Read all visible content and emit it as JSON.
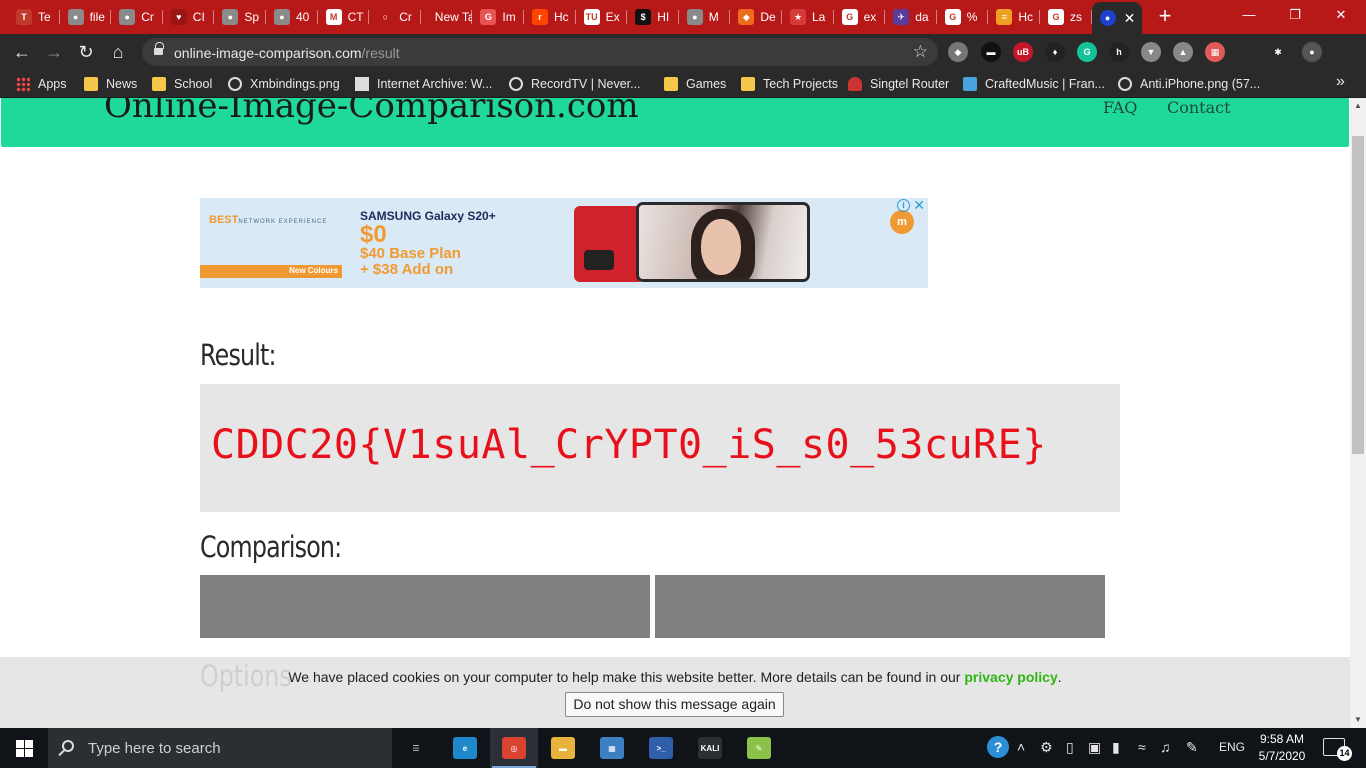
{
  "browser": {
    "tabs": [
      {
        "title": "Te",
        "favicon_color": "#c0392b",
        "favicon_glyph": "T"
      },
      {
        "title": "file",
        "favicon_color": "#8a8a8a",
        "favicon_glyph": "●"
      },
      {
        "title": "Cr",
        "favicon_color": "#8a8a8a",
        "favicon_glyph": "●"
      },
      {
        "title": "CI",
        "favicon_color": "#9b1515",
        "favicon_glyph": "♥"
      },
      {
        "title": "Sp",
        "favicon_color": "#8a8a8a",
        "favicon_glyph": "●"
      },
      {
        "title": "40",
        "favicon_color": "#8a8a8a",
        "favicon_glyph": "●"
      },
      {
        "title": "CT",
        "favicon_color": "#ffffff",
        "favicon_glyph": "M"
      },
      {
        "title": "Cr",
        "favicon_color": "#b71818",
        "favicon_glyph": "○"
      },
      {
        "title": "New Ta",
        "favicon_color": "",
        "favicon_glyph": ""
      },
      {
        "title": "Im",
        "favicon_color": "#e85454",
        "favicon_glyph": "G"
      },
      {
        "title": "Hc",
        "favicon_color": "#ff4500",
        "favicon_glyph": "r"
      },
      {
        "title": "Ex",
        "favicon_color": "#ffffff",
        "favicon_glyph": "TU"
      },
      {
        "title": "HI",
        "favicon_color": "#111111",
        "favicon_glyph": "$"
      },
      {
        "title": "M",
        "favicon_color": "#8a8a8a",
        "favicon_glyph": "●"
      },
      {
        "title": "De",
        "favicon_color": "#ef6c1c",
        "favicon_glyph": "◆"
      },
      {
        "title": "La",
        "favicon_color": "#d63a3a",
        "favicon_glyph": "★"
      },
      {
        "title": "ex",
        "favicon_color": "#ffffff",
        "favicon_glyph": "G"
      },
      {
        "title": "da",
        "favicon_color": "#5a3b9a",
        "favicon_glyph": "✈"
      },
      {
        "title": "%",
        "favicon_color": "#ffffff",
        "favicon_glyph": "G"
      },
      {
        "title": "Hc",
        "favicon_color": "#f0a020",
        "favicon_glyph": "≡"
      },
      {
        "title": "zs",
        "favicon_color": "#ffffff",
        "favicon_glyph": "G"
      }
    ],
    "active_tab_glyph": "●",
    "new_tab": "+",
    "window": {
      "minimize": "—",
      "maximize": "❐",
      "close": "✕"
    },
    "nav": {
      "back": "←",
      "forward": "→",
      "reload": "↻",
      "home": "⌂"
    },
    "url": {
      "host": "online-image-comparison.com",
      "path": "/result"
    },
    "bookmarks": [
      {
        "label": "Apps",
        "icon": "grid"
      },
      {
        "label": "News",
        "icon": "folder"
      },
      {
        "label": "School",
        "icon": "folder"
      },
      {
        "label": "Xmbindings.png",
        "icon": "globe"
      },
      {
        "label": "Internet Archive: W...",
        "icon": "ia"
      },
      {
        "label": "RecordTV | Never...",
        "icon": "globe"
      },
      {
        "label": "Games",
        "icon": "folder"
      },
      {
        "label": "Tech Projects",
        "icon": "folder"
      },
      {
        "label": "Singtel Router",
        "icon": "sing"
      },
      {
        "label": "CraftedMusic | Fran...",
        "icon": "img"
      },
      {
        "label": "Anti.iPhone.png (57...",
        "icon": "globe"
      }
    ],
    "bookmarks_more": "»",
    "extensions": [
      "shield-icon",
      "mask-icon",
      "ublock-icon",
      "wrench-icon",
      "grammarly-icon",
      "h-icon",
      "vue-icon",
      "drive-icon",
      "palette-icon",
      "puzzle-icon",
      "profile-avatar"
    ],
    "ublock_label": "uB"
  },
  "site": {
    "logo": "Online-Image-Comparison.com",
    "nav": [
      "FAQ",
      "Contact"
    ],
    "accent": "#1fd89b",
    "ad": {
      "best": "BEST",
      "best_sub": "NETWORK EXPERIENCE",
      "stripe": "New Colours",
      "model": "SAMSUNG Galaxy S20+",
      "price": "$0",
      "plan1": "$40 Base Plan",
      "plan2": "+ $38 Add on",
      "logo": "m",
      "adchoice": "i",
      "close": "✕"
    },
    "result_heading": "Result:",
    "result_text": "CDDC20{V1suAl_CrYPT0_iS_s0_53cuRE}",
    "result_color": "#e8101a",
    "comparison_heading": "Comparison:",
    "options_heading_ghost": "Options"
  },
  "cookie": {
    "message": "We have placed cookies on your computer to help make this website better. More details can be found in our ",
    "link": "privacy policy",
    "period": ".",
    "button": "Do not show this message again"
  },
  "taskbar": {
    "search_placeholder": "Type here to search",
    "apps": [
      {
        "name": "task-view-icon",
        "glyph": "☰",
        "color": "",
        "running": false
      },
      {
        "name": "edge-icon",
        "glyph": "e",
        "color": "#1e88c9",
        "running": false
      },
      {
        "name": "chrome-icon",
        "glyph": "◎",
        "color": "#d9432f",
        "running": true
      },
      {
        "name": "file-explorer-icon",
        "glyph": "▬",
        "color": "#e8b33a",
        "running": false
      },
      {
        "name": "control-panel-icon",
        "glyph": "▦",
        "color": "#3d7fc2",
        "running": false
      },
      {
        "name": "powershell-icon",
        "glyph": ">_",
        "color": "#2f5fa8",
        "running": false
      },
      {
        "name": "kali-icon",
        "glyph": "KALI",
        "color": "#2b2f33",
        "running": false
      },
      {
        "name": "notepadpp-icon",
        "glyph": "✎",
        "color": "#8bc34a",
        "running": false
      }
    ],
    "tray": {
      "help": "?",
      "chevron": "˄",
      "lang": "ENG"
    },
    "clock": {
      "time": "9:58 AM",
      "date": "5/7/2020"
    },
    "notifications": "14"
  }
}
